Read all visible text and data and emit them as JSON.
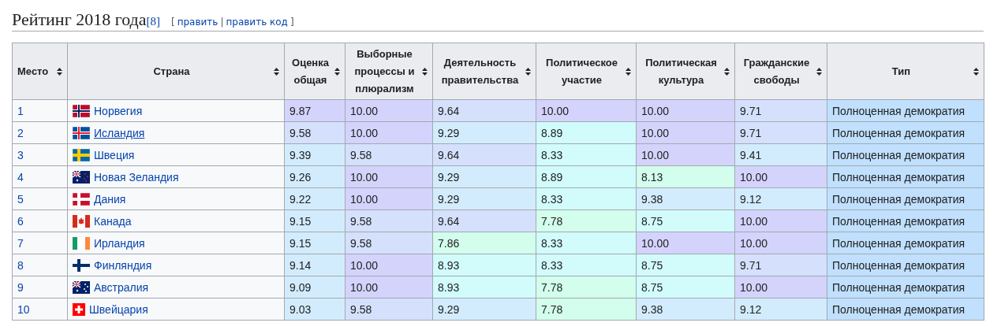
{
  "heading": {
    "title": "Рейтинг 2018 года",
    "reference": "[8]",
    "edit": {
      "open": "[",
      "links": [
        "править",
        "править код"
      ],
      "separator": "|",
      "close": "]"
    }
  },
  "table": {
    "columns": [
      "Место",
      "Страна",
      "Оценка общая",
      "Выборные процессы и плюрализм",
      "Деятельность правительства",
      "Политическое участие",
      "Политическая культура",
      "Гражданские свободы",
      "Тип"
    ],
    "rows": [
      {
        "place": "1",
        "flag": {
          "kind": "norway"
        },
        "country": "Норвегия",
        "hovered": false,
        "scores": [
          {
            "value": "9.87",
            "color": "#d4d3fc"
          },
          {
            "value": "10.00",
            "color": "#d4d3fc"
          },
          {
            "value": "9.64",
            "color": "#d5e0fc"
          },
          {
            "value": "10.00",
            "color": "#d4d3fc"
          },
          {
            "value": "10.00",
            "color": "#d4d3fc"
          },
          {
            "value": "9.71",
            "color": "#d5e0fc"
          }
        ],
        "type": "Полноценная демократия"
      },
      {
        "place": "2",
        "flag": {
          "kind": "iceland"
        },
        "country": "Исландия",
        "hovered": true,
        "scores": [
          {
            "value": "9.58",
            "color": "#d5e0fc"
          },
          {
            "value": "10.00",
            "color": "#d4d3fc"
          },
          {
            "value": "9.29",
            "color": "#d3ecfd"
          },
          {
            "value": "8.89",
            "color": "#d2fbfc"
          },
          {
            "value": "10.00",
            "color": "#d4d3fc"
          },
          {
            "value": "9.71",
            "color": "#d5e0fc"
          }
        ],
        "type": "Полноценная демократия"
      },
      {
        "place": "3",
        "flag": {
          "kind": "sweden"
        },
        "country": "Швеция",
        "hovered": false,
        "scores": [
          {
            "value": "9.39",
            "color": "#d3ecfd"
          },
          {
            "value": "9.58",
            "color": "#d5e0fc"
          },
          {
            "value": "9.64",
            "color": "#d5e0fc"
          },
          {
            "value": "8.33",
            "color": "#d2fbfc"
          },
          {
            "value": "10.00",
            "color": "#d4d3fc"
          },
          {
            "value": "9.41",
            "color": "#d3ecfd"
          }
        ],
        "type": "Полноценная демократия"
      },
      {
        "place": "4",
        "flag": {
          "kind": "new-zealand"
        },
        "country": "Новая Зеландия",
        "hovered": false,
        "scores": [
          {
            "value": "9.26",
            "color": "#d3ecfd"
          },
          {
            "value": "10.00",
            "color": "#d4d3fc"
          },
          {
            "value": "9.29",
            "color": "#d3ecfd"
          },
          {
            "value": "8.89",
            "color": "#d2fbfc"
          },
          {
            "value": "8.13",
            "color": "#d3fdec"
          },
          {
            "value": "10.00",
            "color": "#d4d3fc"
          }
        ],
        "type": "Полноценная демократия"
      },
      {
        "place": "5",
        "flag": {
          "kind": "denmark"
        },
        "country": "Дания",
        "hovered": false,
        "scores": [
          {
            "value": "9.22",
            "color": "#d3ecfd"
          },
          {
            "value": "10.00",
            "color": "#d4d3fc"
          },
          {
            "value": "9.29",
            "color": "#d3ecfd"
          },
          {
            "value": "8.33",
            "color": "#d2fbfc"
          },
          {
            "value": "9.38",
            "color": "#d3ecfd"
          },
          {
            "value": "9.12",
            "color": "#d3ecfd"
          }
        ],
        "type": "Полноценная демократия"
      },
      {
        "place": "6",
        "flag": {
          "kind": "canada"
        },
        "country": "Канада",
        "hovered": false,
        "scores": [
          {
            "value": "9.15",
            "color": "#d3ecfd"
          },
          {
            "value": "9.58",
            "color": "#d5e0fc"
          },
          {
            "value": "9.64",
            "color": "#d5e0fc"
          },
          {
            "value": "7.78",
            "color": "#d3fdec"
          },
          {
            "value": "8.75",
            "color": "#d2fbfc"
          },
          {
            "value": "10.00",
            "color": "#d4d3fc"
          }
        ],
        "type": "Полноценная демократия"
      },
      {
        "place": "7",
        "flag": {
          "kind": "ireland"
        },
        "country": "Ирландия",
        "hovered": false,
        "scores": [
          {
            "value": "9.15",
            "color": "#d3ecfd"
          },
          {
            "value": "9.58",
            "color": "#d5e0fc"
          },
          {
            "value": "7.86",
            "color": "#d3fdec"
          },
          {
            "value": "8.33",
            "color": "#d2fbfc"
          },
          {
            "value": "10.00",
            "color": "#d4d3fc"
          },
          {
            "value": "10.00",
            "color": "#d4d3fc"
          }
        ],
        "type": "Полноценная демократия"
      },
      {
        "place": "8",
        "flag": {
          "kind": "finland"
        },
        "country": "Финляндия",
        "hovered": false,
        "scores": [
          {
            "value": "9.14",
            "color": "#d3ecfd"
          },
          {
            "value": "10.00",
            "color": "#d4d3fc"
          },
          {
            "value": "8.93",
            "color": "#d2fbfc"
          },
          {
            "value": "8.33",
            "color": "#d2fbfc"
          },
          {
            "value": "8.75",
            "color": "#d2fbfc"
          },
          {
            "value": "9.71",
            "color": "#d5e0fc"
          }
        ],
        "type": "Полноценная демократия"
      },
      {
        "place": "9",
        "flag": {
          "kind": "australia"
        },
        "country": "Австралия",
        "hovered": false,
        "scores": [
          {
            "value": "9.09",
            "color": "#d3ecfd"
          },
          {
            "value": "10.00",
            "color": "#d4d3fc"
          },
          {
            "value": "8.93",
            "color": "#d2fbfc"
          },
          {
            "value": "7.78",
            "color": "#d3fdec"
          },
          {
            "value": "8.75",
            "color": "#d2fbfc"
          },
          {
            "value": "10.00",
            "color": "#d4d3fc"
          }
        ],
        "type": "Полноценная демократия"
      },
      {
        "place": "10",
        "flag": {
          "kind": "switzerland"
        },
        "country": "Швейцария",
        "hovered": false,
        "scores": [
          {
            "value": "9.03",
            "color": "#d3ecfd"
          },
          {
            "value": "9.58",
            "color": "#d5e0fc"
          },
          {
            "value": "9.29",
            "color": "#d3ecfd"
          },
          {
            "value": "7.78",
            "color": "#d3fdec"
          },
          {
            "value": "9.38",
            "color": "#d3ecfd"
          },
          {
            "value": "9.12",
            "color": "#d3ecfd"
          }
        ],
        "type": "Полноценная демократия"
      }
    ]
  }
}
